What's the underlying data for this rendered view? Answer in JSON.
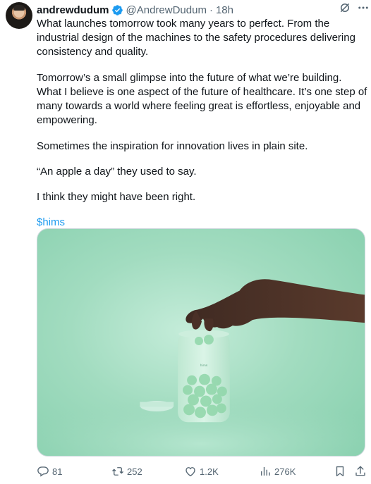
{
  "author": {
    "name": "andrewdudum",
    "handle": "@AndrewDudum",
    "time": "18h",
    "verified": true,
    "avatar": "avatar"
  },
  "tweet": {
    "paragraphs": [
      "What launches tomorrow took many years to perfect. From the industrial design of the machines to the safety procedures delivering consistency and quality.",
      "Tomorrow’s a small glimpse into the future of what we’re building. What I believe is one aspect of the future of healthcare. It’s one step of many towards a world where feeling great is effortless, enjoyable and empowering.",
      "Sometimes the inspiration for innovation lives in plain site.",
      "“An apple a day” they used to say.",
      "I think they might have been right."
    ],
    "cashtag": "$hims"
  },
  "media": {
    "label": "photo of a hand reaching into a frosted jar of green gummies",
    "jar_text": "hims"
  },
  "actions": {
    "replies": "81",
    "reposts": "252",
    "likes": "1.2K",
    "views": "276K"
  },
  "icons": [
    "verified-badge-icon",
    "grok-icon",
    "more-icon",
    "reply-icon",
    "retweet-icon",
    "like-icon",
    "views-icon",
    "bookmark-icon",
    "share-icon"
  ],
  "colors": {
    "link": "#1d9bf0",
    "secondary": "#536471",
    "text": "#0f1419"
  }
}
